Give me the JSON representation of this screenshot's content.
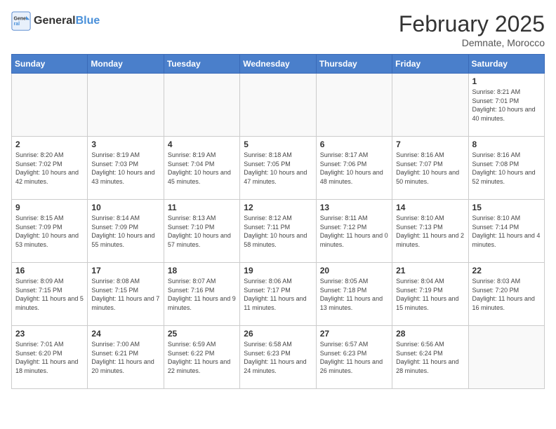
{
  "header": {
    "logo_general": "General",
    "logo_blue": "Blue",
    "title": "February 2025",
    "subtitle": "Demnate, Morocco"
  },
  "weekdays": [
    "Sunday",
    "Monday",
    "Tuesday",
    "Wednesday",
    "Thursday",
    "Friday",
    "Saturday"
  ],
  "weeks": [
    [
      {
        "day": "",
        "info": ""
      },
      {
        "day": "",
        "info": ""
      },
      {
        "day": "",
        "info": ""
      },
      {
        "day": "",
        "info": ""
      },
      {
        "day": "",
        "info": ""
      },
      {
        "day": "",
        "info": ""
      },
      {
        "day": "1",
        "info": "Sunrise: 8:21 AM\nSunset: 7:01 PM\nDaylight: 10 hours and 40 minutes."
      }
    ],
    [
      {
        "day": "2",
        "info": "Sunrise: 8:20 AM\nSunset: 7:02 PM\nDaylight: 10 hours and 42 minutes."
      },
      {
        "day": "3",
        "info": "Sunrise: 8:19 AM\nSunset: 7:03 PM\nDaylight: 10 hours and 43 minutes."
      },
      {
        "day": "4",
        "info": "Sunrise: 8:19 AM\nSunset: 7:04 PM\nDaylight: 10 hours and 45 minutes."
      },
      {
        "day": "5",
        "info": "Sunrise: 8:18 AM\nSunset: 7:05 PM\nDaylight: 10 hours and 47 minutes."
      },
      {
        "day": "6",
        "info": "Sunrise: 8:17 AM\nSunset: 7:06 PM\nDaylight: 10 hours and 48 minutes."
      },
      {
        "day": "7",
        "info": "Sunrise: 8:16 AM\nSunset: 7:07 PM\nDaylight: 10 hours and 50 minutes."
      },
      {
        "day": "8",
        "info": "Sunrise: 8:16 AM\nSunset: 7:08 PM\nDaylight: 10 hours and 52 minutes."
      }
    ],
    [
      {
        "day": "9",
        "info": "Sunrise: 8:15 AM\nSunset: 7:09 PM\nDaylight: 10 hours and 53 minutes."
      },
      {
        "day": "10",
        "info": "Sunrise: 8:14 AM\nSunset: 7:09 PM\nDaylight: 10 hours and 55 minutes."
      },
      {
        "day": "11",
        "info": "Sunrise: 8:13 AM\nSunset: 7:10 PM\nDaylight: 10 hours and 57 minutes."
      },
      {
        "day": "12",
        "info": "Sunrise: 8:12 AM\nSunset: 7:11 PM\nDaylight: 10 hours and 58 minutes."
      },
      {
        "day": "13",
        "info": "Sunrise: 8:11 AM\nSunset: 7:12 PM\nDaylight: 11 hours and 0 minutes."
      },
      {
        "day": "14",
        "info": "Sunrise: 8:10 AM\nSunset: 7:13 PM\nDaylight: 11 hours and 2 minutes."
      },
      {
        "day": "15",
        "info": "Sunrise: 8:10 AM\nSunset: 7:14 PM\nDaylight: 11 hours and 4 minutes."
      }
    ],
    [
      {
        "day": "16",
        "info": "Sunrise: 8:09 AM\nSunset: 7:15 PM\nDaylight: 11 hours and 5 minutes."
      },
      {
        "day": "17",
        "info": "Sunrise: 8:08 AM\nSunset: 7:15 PM\nDaylight: 11 hours and 7 minutes."
      },
      {
        "day": "18",
        "info": "Sunrise: 8:07 AM\nSunset: 7:16 PM\nDaylight: 11 hours and 9 minutes."
      },
      {
        "day": "19",
        "info": "Sunrise: 8:06 AM\nSunset: 7:17 PM\nDaylight: 11 hours and 11 minutes."
      },
      {
        "day": "20",
        "info": "Sunrise: 8:05 AM\nSunset: 7:18 PM\nDaylight: 11 hours and 13 minutes."
      },
      {
        "day": "21",
        "info": "Sunrise: 8:04 AM\nSunset: 7:19 PM\nDaylight: 11 hours and 15 minutes."
      },
      {
        "day": "22",
        "info": "Sunrise: 8:03 AM\nSunset: 7:20 PM\nDaylight: 11 hours and 16 minutes."
      }
    ],
    [
      {
        "day": "23",
        "info": "Sunrise: 7:01 AM\nSunset: 6:20 PM\nDaylight: 11 hours and 18 minutes."
      },
      {
        "day": "24",
        "info": "Sunrise: 7:00 AM\nSunset: 6:21 PM\nDaylight: 11 hours and 20 minutes."
      },
      {
        "day": "25",
        "info": "Sunrise: 6:59 AM\nSunset: 6:22 PM\nDaylight: 11 hours and 22 minutes."
      },
      {
        "day": "26",
        "info": "Sunrise: 6:58 AM\nSunset: 6:23 PM\nDaylight: 11 hours and 24 minutes."
      },
      {
        "day": "27",
        "info": "Sunrise: 6:57 AM\nSunset: 6:23 PM\nDaylight: 11 hours and 26 minutes."
      },
      {
        "day": "28",
        "info": "Sunrise: 6:56 AM\nSunset: 6:24 PM\nDaylight: 11 hours and 28 minutes."
      },
      {
        "day": "",
        "info": ""
      }
    ]
  ]
}
